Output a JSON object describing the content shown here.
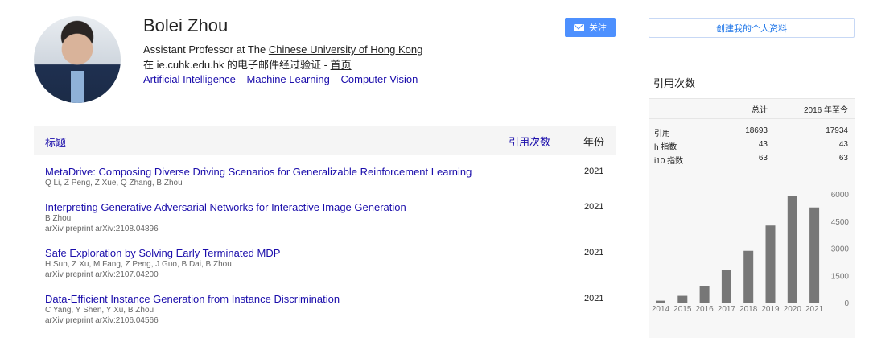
{
  "profile": {
    "name": "Bolei Zhou",
    "affiliation_prefix": "Assistant Professor at The ",
    "affiliation_link": "Chinese University of Hong Kong",
    "verified_email": "在 ie.cuhk.edu.hk 的电子邮件经过验证 - ",
    "homepage_link": "首页",
    "interests": [
      "Artificial Intelligence",
      "Machine Learning",
      "Computer Vision"
    ]
  },
  "buttons": {
    "follow": "关注",
    "create_profile": "创建我的个人资料"
  },
  "table": {
    "col_title": "标题",
    "col_cited": "引用次数",
    "col_year": "年份"
  },
  "publications": [
    {
      "title": "MetaDrive: Composing Diverse Driving Scenarios for Generalizable Reinforcement Learning",
      "authors": "Q Li, Z Peng, Z Xue, Q Zhang, B Zhou",
      "venue": "",
      "year": "2021"
    },
    {
      "title": "Interpreting Generative Adversarial Networks for Interactive Image Generation",
      "authors": "B Zhou",
      "venue": "arXiv preprint arXiv:2108.04896",
      "year": "2021"
    },
    {
      "title": "Safe Exploration by Solving Early Terminated MDP",
      "authors": "H Sun, Z Xu, M Fang, Z Peng, J Guo, B Dai, B Zhou",
      "venue": "arXiv preprint arXiv:2107.04200",
      "year": "2021"
    },
    {
      "title": "Data-Efficient Instance Generation from Instance Discrimination",
      "authors": "C Yang, Y Shen, Y Xu, B Zhou",
      "venue": "arXiv preprint arXiv:2106.04566",
      "year": "2021"
    }
  ],
  "citations": {
    "heading": "引用次数",
    "col_all": "总计",
    "col_since": "2016 年至今",
    "rows": [
      {
        "label": "引用",
        "all": "18693",
        "since": "17934"
      },
      {
        "label": "h 指数",
        "all": "43",
        "since": "43"
      },
      {
        "label": "i10 指数",
        "all": "63",
        "since": "63"
      }
    ]
  },
  "chart_data": {
    "type": "bar",
    "categories": [
      "2014",
      "2015",
      "2016",
      "2017",
      "2018",
      "2019",
      "2020",
      "2021"
    ],
    "values": [
      150,
      420,
      950,
      1850,
      2900,
      4300,
      5950,
      5300
    ],
    "yticks": [
      "0",
      "1500",
      "3000",
      "4500",
      "6000"
    ],
    "ylim": [
      0,
      6000
    ],
    "bar_color": "#777777"
  }
}
